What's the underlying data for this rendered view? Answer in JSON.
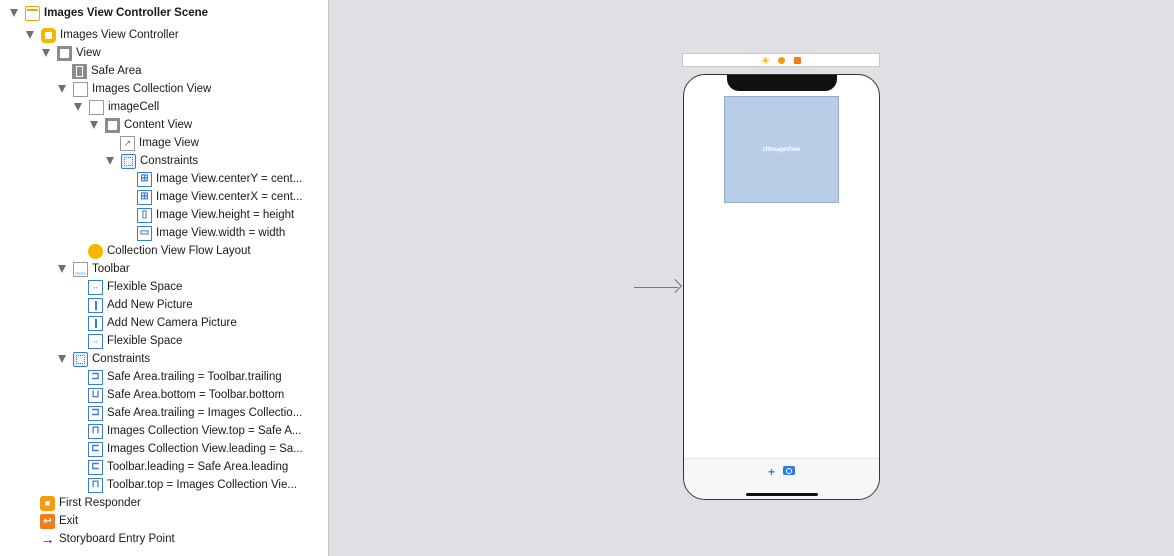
{
  "outline": {
    "rows": [
      {
        "label": "Images View Controller Scene",
        "icon": "scene-icon"
      },
      {
        "label": "Images View Controller",
        "icon": "view-controller-icon"
      },
      {
        "label": "View",
        "icon": "view-icon"
      },
      {
        "label": "Safe Area",
        "icon": "safe-area-icon"
      },
      {
        "label": "Images Collection View",
        "icon": "collection-view-icon"
      },
      {
        "label": "imageCell",
        "icon": "collection-cell-icon"
      },
      {
        "label": "Content View",
        "icon": "view-icon"
      },
      {
        "label": "Image View",
        "icon": "image-view-icon"
      },
      {
        "label": "Constraints",
        "icon": "constraints-icon"
      },
      {
        "label": "Image View.centerY = cent...",
        "icon": "constraint-center-icon"
      },
      {
        "label": "Image View.centerX = cent...",
        "icon": "constraint-center-icon"
      },
      {
        "label": "Image View.height = height",
        "icon": "constraint-height-icon"
      },
      {
        "label": "Image View.width = width",
        "icon": "constraint-width-icon"
      },
      {
        "label": "Collection View Flow Layout",
        "icon": "flow-layout-icon"
      },
      {
        "label": "Toolbar",
        "icon": "toolbar-icon"
      },
      {
        "label": "Flexible Space",
        "icon": "flexible-space-icon"
      },
      {
        "label": "Add New Picture",
        "icon": "bar-button-icon"
      },
      {
        "label": "Add New Camera Picture",
        "icon": "bar-button-icon"
      },
      {
        "label": "Flexible Space",
        "icon": "flexible-space-icon"
      },
      {
        "label": "Constraints",
        "icon": "constraints-icon"
      },
      {
        "label": "Safe Area.trailing = Toolbar.trailing",
        "icon": "constraint-trailing-icon"
      },
      {
        "label": "Safe Area.bottom = Toolbar.bottom",
        "icon": "constraint-bottom-icon"
      },
      {
        "label": "Safe Area.trailing = Images Collectio...",
        "icon": "constraint-trailing-icon"
      },
      {
        "label": "Images Collection View.top = Safe A...",
        "icon": "constraint-top-icon"
      },
      {
        "label": "Images Collection View.leading = Sa...",
        "icon": "constraint-leading-icon"
      },
      {
        "label": "Toolbar.leading = Safe Area.leading",
        "icon": "constraint-leading-icon"
      },
      {
        "label": "Toolbar.top = Images Collection Vie...",
        "icon": "constraint-top-icon"
      },
      {
        "label": "First Responder",
        "icon": "first-responder-icon"
      },
      {
        "label": "Exit",
        "icon": "exit-icon"
      },
      {
        "label": "Storyboard Entry Point",
        "icon": "arrow-right-icon"
      }
    ]
  },
  "canvas": {
    "cell_label": "UIImageView",
    "toolbar_icons": [
      "plus-icon",
      "camera-icon"
    ]
  },
  "colors": {
    "canvas_bg": "#e0e0e4",
    "accent_yellow": "#f7b500",
    "accent_blue": "#2f7de1",
    "cell_fill": "#b9cde6"
  }
}
